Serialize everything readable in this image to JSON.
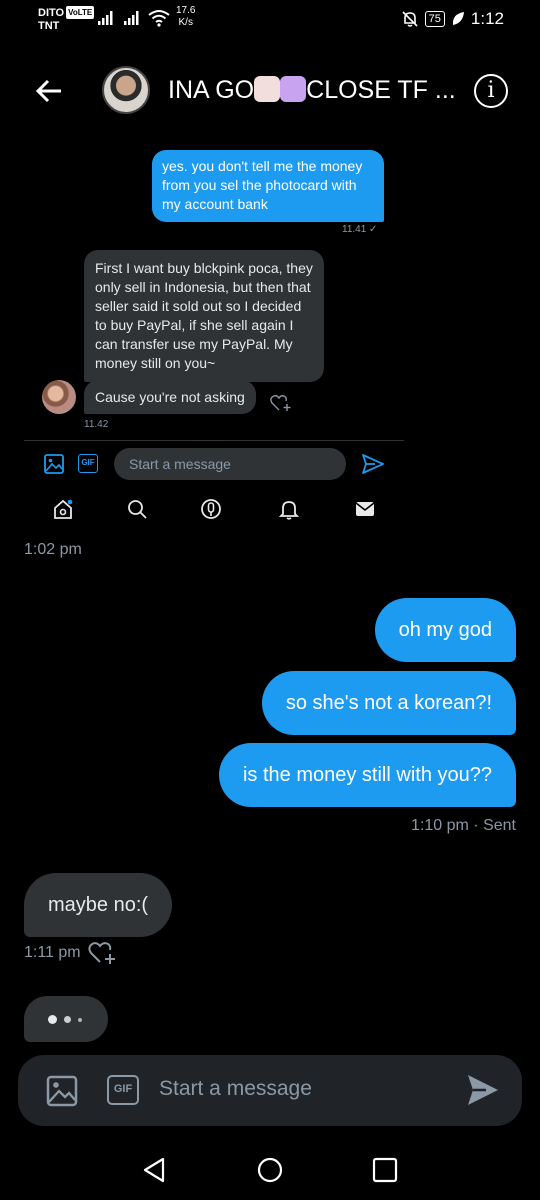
{
  "status_bar": {
    "carrier_line1": "DITO",
    "carrier_volte": "VoLTE",
    "carrier_line2": "TNT",
    "net_speed_value": "17.6",
    "net_speed_unit": "K/s",
    "battery": "75",
    "time": "1:12"
  },
  "header": {
    "title_part1": "INA GO",
    "title_part2": "CLOSE TF ...",
    "info_glyph": "i"
  },
  "embedded_screenshot": {
    "outgoing_message": "yes. you don't tell me the money from you sel the photocard with my account bank",
    "outgoing_time": "11.41 ✓",
    "incoming_message": "First I want buy blckpink poca, they only sell in Indonesia, but then that seller said it sold out so I decided to buy PayPal, if she sell again I can transfer use my PayPal. My money still on you~",
    "incoming_message2": "Cause you're not asking",
    "incoming_time": "11.42",
    "composer_placeholder": "Start a message",
    "gif_label": "GIF"
  },
  "conversation": {
    "day_time": "1:02 pm",
    "outgoing": [
      "oh my god",
      "so she's not a korean?!",
      "is the money still with you??"
    ],
    "sent_meta": "1:10 pm · Sent",
    "incoming": "maybe no:(",
    "incoming_time": "1:11 pm"
  },
  "composer": {
    "placeholder": "Start a message",
    "gif_label": "GIF"
  },
  "colors": {
    "accent": "#1d9bf0",
    "background": "#000000",
    "incoming_bubble": "#2f3336",
    "muted_text": "#8b98a5"
  },
  "icons": [
    "back-arrow-icon",
    "info-icon",
    "media-icon",
    "gif-icon",
    "send-icon",
    "heart-plus-icon",
    "home-icon",
    "search-icon",
    "spaces-icon",
    "bell-icon",
    "mail-icon",
    "nav-back-icon",
    "nav-home-icon",
    "nav-recents-icon"
  ]
}
